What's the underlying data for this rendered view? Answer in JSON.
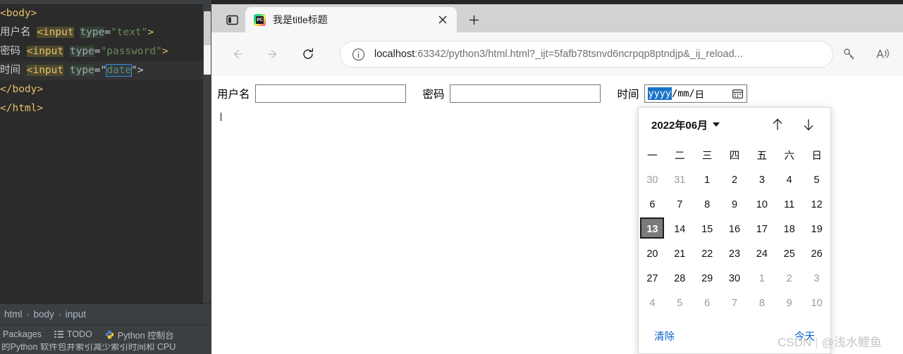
{
  "ide": {
    "code_lines": [
      {
        "id": "line-body-open",
        "parts": [
          {
            "t": "<body>",
            "cls": "tok-tag"
          }
        ]
      },
      {
        "id": "line-username",
        "parts": [
          {
            "t": "用户名 ",
            "cls": "tok-plain"
          },
          {
            "t": "<input",
            "cls": "tok-tag hl-ident"
          },
          {
            "t": " ",
            "cls": "tok-plain"
          },
          {
            "t": "type",
            "cls": "tok-attr hl-attr"
          },
          {
            "t": "=",
            "cls": "tok-plain"
          },
          {
            "t": "\"text\"",
            "cls": "tok-str"
          },
          {
            "t": ">",
            "cls": "tok-tag"
          }
        ]
      },
      {
        "id": "line-password",
        "parts": [
          {
            "t": "密码 ",
            "cls": "tok-plain"
          },
          {
            "t": "<input",
            "cls": "tok-tag hl-ident"
          },
          {
            "t": " ",
            "cls": "tok-plain"
          },
          {
            "t": "type",
            "cls": "tok-attr hl-attr"
          },
          {
            "t": "=",
            "cls": "tok-plain"
          },
          {
            "t": "\"password\"",
            "cls": "tok-str"
          },
          {
            "t": ">",
            "cls": "tok-tag"
          }
        ]
      },
      {
        "id": "line-date",
        "highlight": true,
        "parts": [
          {
            "t": "时间 ",
            "cls": "tok-plain"
          },
          {
            "t": "<input",
            "cls": "tok-tag hl-ident"
          },
          {
            "t": " ",
            "cls": "tok-plain"
          },
          {
            "t": "type",
            "cls": "tok-attr hl-attr"
          },
          {
            "t": "=\"",
            "cls": "tok-plain"
          },
          {
            "t": "date",
            "cls": "tok-str sel-box"
          },
          {
            "t": "\">",
            "cls": "tok-plain"
          }
        ]
      },
      {
        "id": "line-body-close",
        "parts": [
          {
            "t": "</body>",
            "cls": "tok-tag"
          }
        ]
      },
      {
        "id": "line-html-close",
        "parts": [
          {
            "t": "</html>",
            "cls": "tok-tag"
          }
        ]
      }
    ],
    "breadcrumb": [
      "html",
      "body",
      "input"
    ],
    "breadcrumb_sep": "›",
    "toolwindows": [
      {
        "label": "Packages",
        "icon": ""
      },
      {
        "label": "TODO",
        "icon": "list-icon"
      },
      {
        "label": "Python 控制台",
        "icon": "python-icon"
      }
    ],
    "status_text": "的Python 软件包并索引减少索引时间和 CPU"
  },
  "browser": {
    "tab": {
      "title": "我是title标题",
      "favicon_text": "PC",
      "close_label": "×"
    },
    "new_tab_label": "+",
    "nav": {
      "back_label": "←",
      "forward_label": "→",
      "reload_label": "↻"
    },
    "omnibox": {
      "host": "localhost",
      "rest": ":63342/python3/html.html?_ijt=5fafb78tsnvd6ncrpqp8ptndjp&_ij_reload..."
    }
  },
  "page": {
    "username_label": "用户名",
    "username_value": "",
    "password_label": "密码",
    "password_value": "",
    "time_label": "时间",
    "date_segments": {
      "year": "yyyy",
      "sep1": "/",
      "month": "mm",
      "sep2": "/",
      "day": "日"
    }
  },
  "calendar": {
    "month_label": "2022年06月",
    "weekdays": [
      "一",
      "二",
      "三",
      "四",
      "五",
      "六",
      "日"
    ],
    "weeks": [
      [
        {
          "d": "30",
          "o": true
        },
        {
          "d": "31",
          "o": true
        },
        {
          "d": "1"
        },
        {
          "d": "2"
        },
        {
          "d": "3"
        },
        {
          "d": "4"
        },
        {
          "d": "5"
        }
      ],
      [
        {
          "d": "6"
        },
        {
          "d": "7"
        },
        {
          "d": "8"
        },
        {
          "d": "9"
        },
        {
          "d": "10"
        },
        {
          "d": "11"
        },
        {
          "d": "12"
        }
      ],
      [
        {
          "d": "13",
          "today": true
        },
        {
          "d": "14"
        },
        {
          "d": "15"
        },
        {
          "d": "16"
        },
        {
          "d": "17"
        },
        {
          "d": "18"
        },
        {
          "d": "19"
        }
      ],
      [
        {
          "d": "20"
        },
        {
          "d": "21"
        },
        {
          "d": "22"
        },
        {
          "d": "23"
        },
        {
          "d": "24"
        },
        {
          "d": "25"
        },
        {
          "d": "26"
        }
      ],
      [
        {
          "d": "27"
        },
        {
          "d": "28"
        },
        {
          "d": "29"
        },
        {
          "d": "30"
        },
        {
          "d": "1",
          "o": true
        },
        {
          "d": "2",
          "o": true
        },
        {
          "d": "3",
          "o": true
        }
      ],
      [
        {
          "d": "4",
          "o": true
        },
        {
          "d": "5",
          "o": true
        },
        {
          "d": "6",
          "o": true
        },
        {
          "d": "7",
          "o": true
        },
        {
          "d": "8",
          "o": true
        },
        {
          "d": "9",
          "o": true
        },
        {
          "d": "10",
          "o": true
        }
      ]
    ],
    "clear_label": "清除",
    "today_label": "今天"
  },
  "watermark": {
    "brand": "CSDN",
    "user": "@浅水鲤鱼"
  }
}
